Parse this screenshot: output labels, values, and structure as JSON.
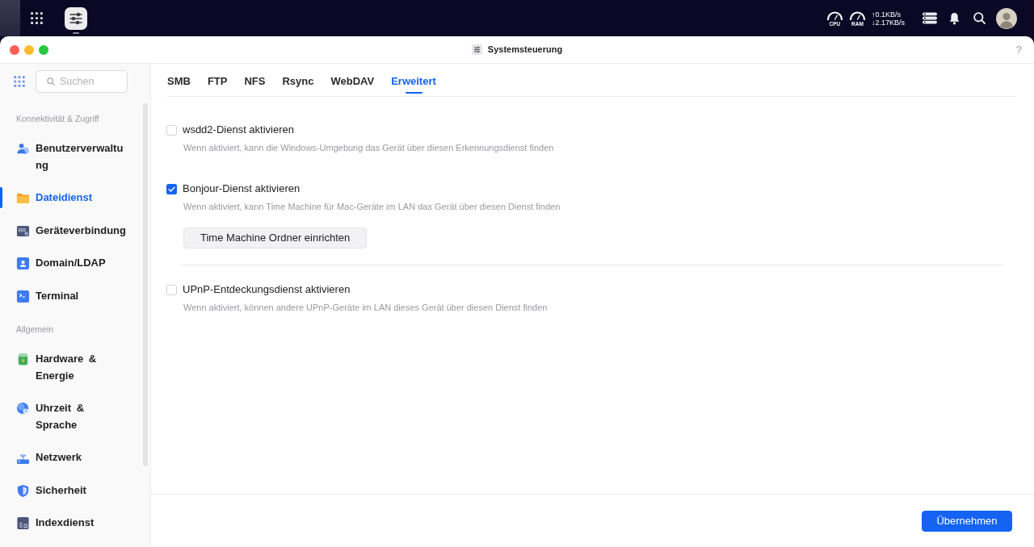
{
  "top_bar": {
    "gauges": [
      {
        "label": "CPU"
      },
      {
        "label": "RAM"
      }
    ],
    "network": {
      "upload": "↑0.1KB/s",
      "download": "↓2.17KB/s"
    }
  },
  "window": {
    "title": "Systemsteuerung",
    "help": "?"
  },
  "sidebar": {
    "search": {
      "placeholder": "Suchen"
    },
    "sections": [
      {
        "title": "Konnektivität & Zugriff",
        "items": [
          {
            "label": "Benutzerverwaltung",
            "selected": false
          },
          {
            "label": "Dateidienst",
            "selected": true
          },
          {
            "label": "Geräteverbindung",
            "selected": false
          },
          {
            "label": "Domain/LDAP",
            "selected": false
          },
          {
            "label": "Terminal",
            "selected": false
          }
        ]
      },
      {
        "title": "Allgemein",
        "items": [
          {
            "label": "Hardware & Energie",
            "selected": false
          },
          {
            "label": "Uhrzeit & Sprache",
            "selected": false
          },
          {
            "label": "Netzwerk",
            "selected": false
          },
          {
            "label": "Sicherheit",
            "selected": false
          },
          {
            "label": "Indexdienst",
            "selected": false
          }
        ]
      }
    ]
  },
  "tabs": [
    {
      "label": "SMB",
      "selected": false
    },
    {
      "label": "FTP",
      "selected": false
    },
    {
      "label": "NFS",
      "selected": false
    },
    {
      "label": "Rsync",
      "selected": false
    },
    {
      "label": "WebDAV",
      "selected": false
    },
    {
      "label": "Erweitert",
      "selected": true
    }
  ],
  "options": [
    {
      "label": "wsdd2-Dienst aktivieren",
      "checked": false,
      "description": "Wenn aktiviert, kann die Windows-Umgebung das Gerät über diesen Erkennungsdienst finden"
    },
    {
      "label": "Bonjour-Dienst aktivieren",
      "checked": true,
      "description": "Wenn aktiviert, kann Time Machine für Mac-Geräte im LAN das Gerät über diesen Dienst finden",
      "button": "Time Machine Ordner einrichten"
    },
    {
      "label": "UPnP-Entdeckungsdienst aktivieren",
      "checked": false,
      "description": "Wenn aktiviert, können andere UPnP-Geräte im LAN dieses Gerät über diesen Dienst finden"
    }
  ],
  "footer": {
    "apply_button": "Übernehmen"
  }
}
